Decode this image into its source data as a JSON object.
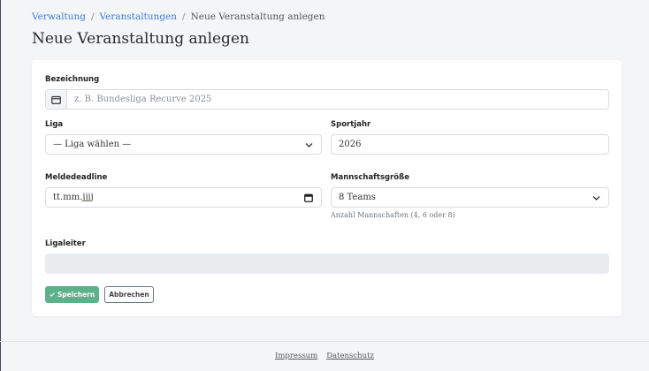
{
  "breadcrumb": {
    "items": [
      "Verwaltung",
      "Veranstaltungen"
    ],
    "separator": "/",
    "current": "Neue Veranstaltung anlegen"
  },
  "page": {
    "title": "Neue Veranstaltung anlegen"
  },
  "form": {
    "bezeichnung": {
      "label": "Bezeichnung",
      "placeholder": "z. B. Bundesliga Recurve 2025",
      "icon": "calendar-icon"
    },
    "liga": {
      "label": "Liga",
      "value": "— Liga wählen —"
    },
    "sportjahr": {
      "label": "Sportjahr",
      "value": "2026"
    },
    "meldedeadline": {
      "label": "Meldedeadline",
      "value": "tt.mm.jjjj"
    },
    "mannschaftsgroesse": {
      "label": "Mannschaftsgröße",
      "value": "8 Teams",
      "help": "Anzahl Mannschaften (4, 6 oder 8)"
    },
    "ligaleiter": {
      "label": "Ligaleiter"
    },
    "save_label": "Speichern",
    "cancel_label": "Abbrechen"
  },
  "footer": {
    "links": [
      "Impressum",
      "Datenschutz"
    ]
  },
  "colors": {
    "link": "#3b7dd8",
    "primary": "#5cb08a"
  }
}
